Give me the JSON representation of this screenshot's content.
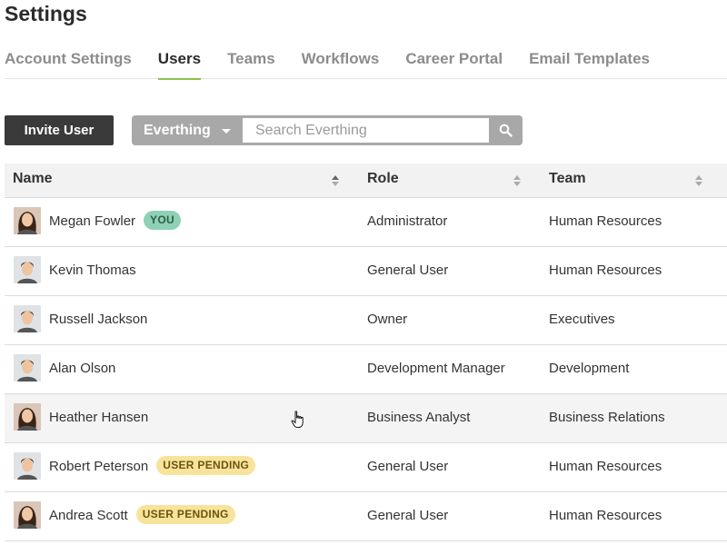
{
  "page": {
    "title": "Settings"
  },
  "tabs": [
    {
      "label": "Account Settings",
      "active": false
    },
    {
      "label": "Users",
      "active": true
    },
    {
      "label": "Teams",
      "active": false
    },
    {
      "label": "Workflows",
      "active": false
    },
    {
      "label": "Career Portal",
      "active": false
    },
    {
      "label": "Email Templates",
      "active": false
    }
  ],
  "toolbar": {
    "invite_label": "Invite User",
    "filter_label": "Everthing",
    "search_placeholder": "Search Everthing",
    "search_value": ""
  },
  "table": {
    "columns": [
      "Name",
      "Role",
      "Team"
    ],
    "rows": [
      {
        "name": "Megan Fowler",
        "badge": "YOU",
        "badge_type": "you",
        "role": "Administrator",
        "team": "Human Resources",
        "avatar_icon": "woman-avatar-icon"
      },
      {
        "name": "Kevin Thomas",
        "badge": "",
        "badge_type": "",
        "role": "General User",
        "team": "Human Resources",
        "avatar_icon": "man-avatar-icon"
      },
      {
        "name": "Russell Jackson",
        "badge": "",
        "badge_type": "",
        "role": "Owner",
        "team": "Executives",
        "avatar_icon": "man-avatar-icon"
      },
      {
        "name": "Alan Olson",
        "badge": "",
        "badge_type": "",
        "role": "Development Manager",
        "team": "Development",
        "avatar_icon": "man-avatar-icon"
      },
      {
        "name": "Heather Hansen",
        "badge": "",
        "badge_type": "",
        "role": "Business Analyst",
        "team": "Business Relations",
        "avatar_icon": "woman-avatar-icon"
      },
      {
        "name": "Robert Peterson",
        "badge": "USER PENDING",
        "badge_type": "pending",
        "role": "General User",
        "team": "Human Resources",
        "avatar_icon": "man-avatar-icon"
      },
      {
        "name": "Andrea Scott",
        "badge": "USER PENDING",
        "badge_type": "pending",
        "role": "General User",
        "team": "Human Resources",
        "avatar_icon": "woman-avatar-icon"
      }
    ]
  },
  "colors": {
    "accent": "#8bc34a",
    "badge_you": "#8ed1b5",
    "badge_pending": "#f8e39a",
    "button_dark": "#3a3a3a"
  }
}
